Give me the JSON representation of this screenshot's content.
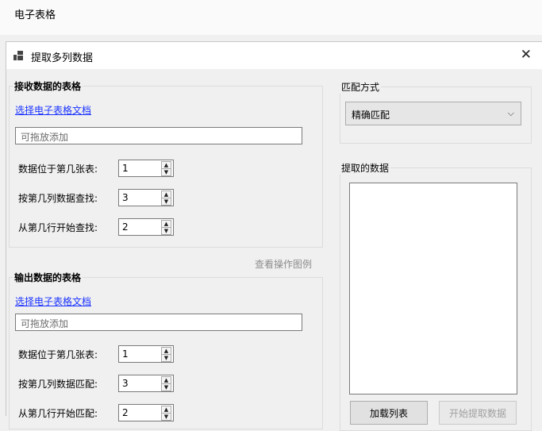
{
  "app": {
    "title": "电子表格"
  },
  "dialog": {
    "title": "提取多列数据",
    "close_glyph": "✕"
  },
  "receive_group": {
    "legend": "接收数据的表格",
    "select_link": "选择电子表格文档",
    "drop_placeholder": "可拖放添加",
    "rows": [
      {
        "label": "数据位于第几张表:",
        "value": "1"
      },
      {
        "label": "按第几列数据查找:",
        "value": "3"
      },
      {
        "label": "从第几行开始查找:",
        "value": "2"
      }
    ]
  },
  "view_example_link": "查看操作图例",
  "output_group": {
    "legend": "输出数据的表格",
    "select_link": "选择电子表格文档",
    "drop_placeholder": "可拖放添加",
    "rows": [
      {
        "label": "数据位于第几张表:",
        "value": "1"
      },
      {
        "label": "按第几列数据匹配:",
        "value": "3"
      },
      {
        "label": "从第几行开始匹配:",
        "value": "2"
      }
    ]
  },
  "match_group": {
    "legend": "匹配方式",
    "selected": "精确匹配"
  },
  "extract_group": {
    "legend": "提取的数据",
    "load_button": "加载列表",
    "start_button": "开始提取数据"
  },
  "spinner": {
    "up": "▲",
    "down": "▼"
  },
  "combo_chevron": "⌵"
}
